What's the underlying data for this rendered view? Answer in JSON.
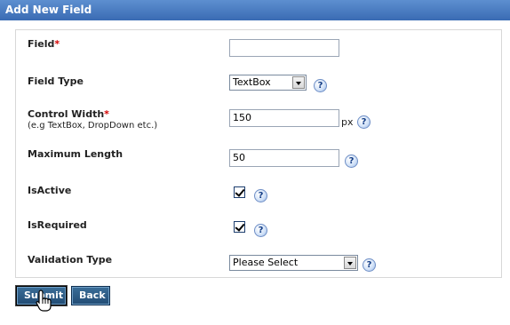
{
  "panel": {
    "title": "Add New Field"
  },
  "fields": {
    "field": {
      "label": "Field",
      "required_mark": "*",
      "value": ""
    },
    "field_type": {
      "label": "Field Type",
      "selected": "TextBox"
    },
    "control_width": {
      "label": "Control Width",
      "required_mark": "*",
      "hint": "(e.g TextBox, DropDown etc.)",
      "value": "150",
      "unit": "px"
    },
    "max_length": {
      "label": "Maximum Length",
      "value": "50"
    },
    "is_active": {
      "label": "IsActive",
      "checked": true
    },
    "is_required": {
      "label": "IsRequired",
      "checked": true
    },
    "validation_type": {
      "label": "Validation Type",
      "selected": "Please Select"
    }
  },
  "help_icon": {
    "glyph": "?"
  },
  "buttons": {
    "submit": "Submit",
    "back": "Back"
  }
}
